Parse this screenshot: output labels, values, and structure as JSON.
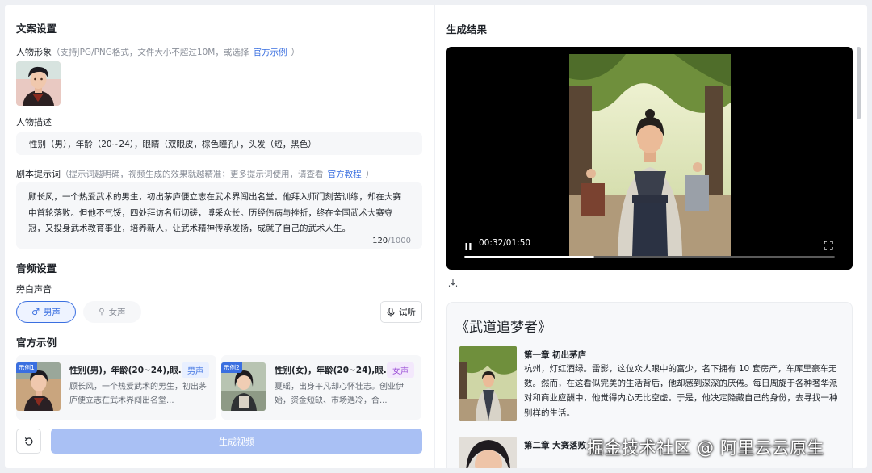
{
  "copy_settings": {
    "title": "文案设置",
    "character_image": {
      "label": "人物形象",
      "hint": "（支持JPG/PNG格式，文件大小不超过10M，或选择",
      "link": "官方示例",
      "hint_end": "）"
    },
    "character_desc": {
      "label": "人物描述",
      "value": "性别（男），年龄（20~24），眼睛（双眼皮，棕色瞳孔），头发（短，黑色）"
    },
    "script_prompt": {
      "label": "剧本提示词",
      "hint": "（提示词越明确，视频生成的效果就越精准；更多提示词使用，请查看",
      "link": "官方教程",
      "hint_end": "）",
      "value": "顾长风，一个热爱武术的男生，初出茅庐便立志在武术界闯出名堂。他拜入师门刻苦训练，却在大赛中首轮落败。但他不气馁，四处拜访名师切磋，博采众长。历经伤病与挫折，终在全国武术大赛夺冠，又投身武术教育事业，培养新人，让武术精神传承发扬，成就了自己的武术人生。",
      "count": "120",
      "max": "/1000"
    }
  },
  "audio_settings": {
    "title": "音频设置",
    "narration_label": "旁白声音",
    "male": "男声",
    "female": "女声",
    "listen": "试听"
  },
  "examples": {
    "title": "官方示例",
    "items": [
      {
        "badge": "示例1",
        "title": "性别(男)，年龄(20~24),眼...",
        "tag": "男声",
        "text": "顾长风，一个热爱武术的男生，初出茅庐便立志在武术界闯出名堂..."
      },
      {
        "badge": "示例2",
        "title": "性别(女)，年龄(20~24),眼...",
        "tag": "女声",
        "text": "夏瑶，出身平凡却心怀壮志。创业伊始，资金短缺、市场遇冷，合..."
      }
    ]
  },
  "actions": {
    "generate": "生成视频"
  },
  "result": {
    "title": "生成结果",
    "time": "00:32/01:50",
    "progress": 0.35
  },
  "story": {
    "title": "《武道追梦者》",
    "chapters": [
      {
        "heading": "第一章 初出茅庐",
        "text": "杭州，灯红酒绿。雷影，这位众人眼中的富少，名下拥有 10 套房产，车库里豪车无数。然而，在这看似完美的生活背后，他却感到深深的厌倦。每日周旋于各种奢华派对和商业应酬中，他觉得内心无比空虚。于是，他决定隐藏自己的身份，去寻找一种别样的生活。"
      },
      {
        "heading": "第二章 大赛落败",
        "text": ""
      }
    ]
  },
  "watermark": "掘金技术社区 @ 阿里云云原生",
  "colors": {
    "accent": "#3a6fe0",
    "generate_bg": "#a9c0f4",
    "female_tag": "#9b4fd6"
  }
}
